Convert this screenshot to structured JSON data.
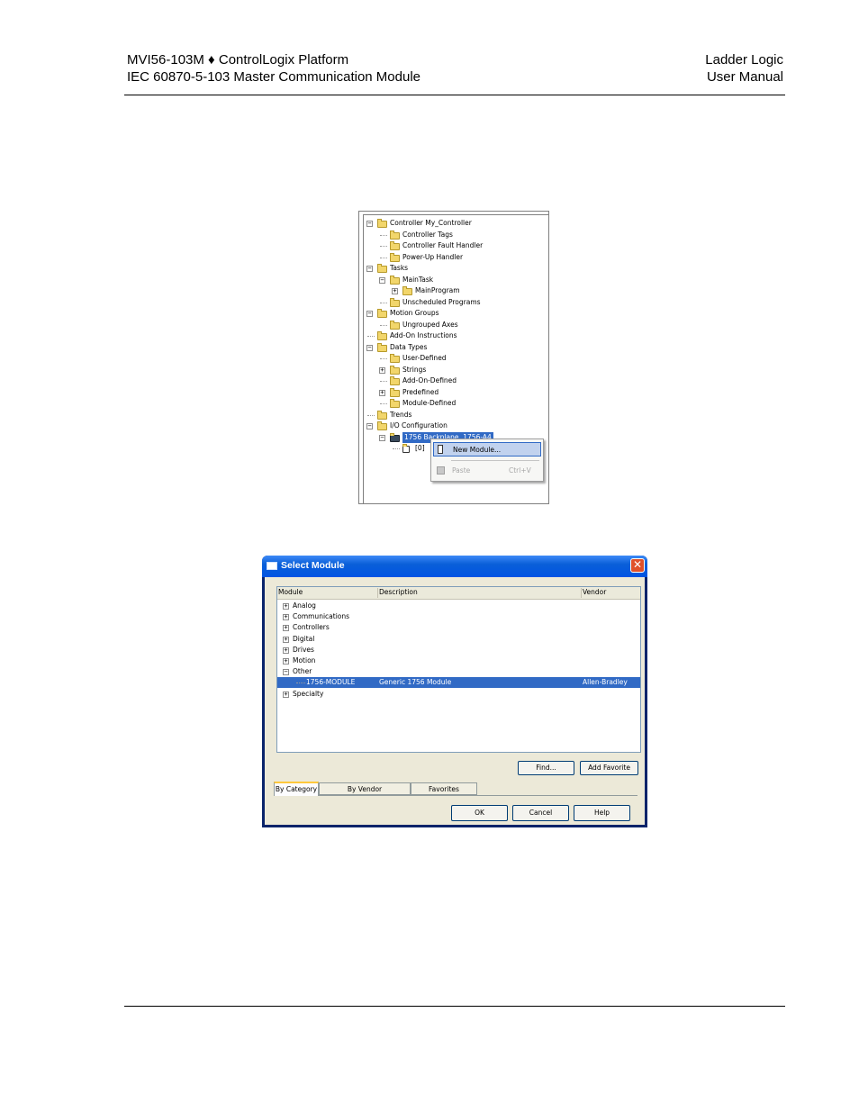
{
  "header": {
    "left_line1": "MVI56-103M ♦ ControlLogix Platform",
    "left_line2": "IEC 60870-5-103 Master Communication Module",
    "right_line1": "Ladder Logic",
    "right_line2": "User Manual"
  },
  "tree": {
    "items": [
      {
        "label": "Controller My_Controller",
        "expander": "−"
      },
      {
        "label": "Controller Tags"
      },
      {
        "label": "Controller Fault Handler"
      },
      {
        "label": "Power-Up Handler"
      },
      {
        "label": "Tasks",
        "expander": "−"
      },
      {
        "label": "MainTask",
        "expander": "−"
      },
      {
        "label": "MainProgram",
        "expander": "+"
      },
      {
        "label": "Unscheduled Programs"
      },
      {
        "label": "Motion Groups",
        "expander": "−"
      },
      {
        "label": "Ungrouped Axes"
      },
      {
        "label": "Add-On Instructions"
      },
      {
        "label": "Data Types",
        "expander": "−"
      },
      {
        "label": "User-Defined"
      },
      {
        "label": "Strings",
        "expander": "+"
      },
      {
        "label": "Add-On-Defined"
      },
      {
        "label": "Predefined",
        "expander": "+"
      },
      {
        "label": "Module-Defined"
      },
      {
        "label": "Trends"
      },
      {
        "label": "I/O Configuration",
        "expander": "−"
      },
      {
        "label": "1756 Backplane, 1756-A4",
        "expander": "−"
      },
      {
        "label": "[0]"
      }
    ],
    "context_menu": {
      "new_module": "New Module...",
      "paste": "Paste",
      "paste_shortcut": "Ctrl+V"
    }
  },
  "dialog": {
    "title": "Select Module",
    "close_glyph": "✕",
    "columns": [
      "Module",
      "Description",
      "Vendor"
    ],
    "rows": [
      {
        "expander": "+",
        "module": "Analog",
        "description": "",
        "vendor": ""
      },
      {
        "expander": "+",
        "module": "Communications",
        "description": "",
        "vendor": ""
      },
      {
        "expander": "+",
        "module": "Controllers",
        "description": "",
        "vendor": ""
      },
      {
        "expander": "+",
        "module": "Digital",
        "description": "",
        "vendor": ""
      },
      {
        "expander": "+",
        "module": "Drives",
        "description": "",
        "vendor": ""
      },
      {
        "expander": "+",
        "module": "Motion",
        "description": "",
        "vendor": ""
      },
      {
        "expander": "−",
        "module": "Other",
        "description": "",
        "vendor": ""
      },
      {
        "expander": "",
        "module": "1756-MODULE",
        "description": "Generic 1756 Module",
        "vendor": "Allen-Bradley",
        "selected": true
      },
      {
        "expander": "+",
        "module": "Specialty",
        "description": "",
        "vendor": ""
      }
    ],
    "find_button": "Find...",
    "add_favorite_button": "Add Favorite",
    "tabs": [
      "By Category",
      "By Vendor",
      "Favorites"
    ],
    "active_tab": "By Category",
    "ok_button": "OK",
    "cancel_button": "Cancel",
    "help_button": "Help"
  },
  "colors": {
    "selection": "#316ac5",
    "title_bar": "#0054e3",
    "dialog_face": "#ece9d8"
  }
}
